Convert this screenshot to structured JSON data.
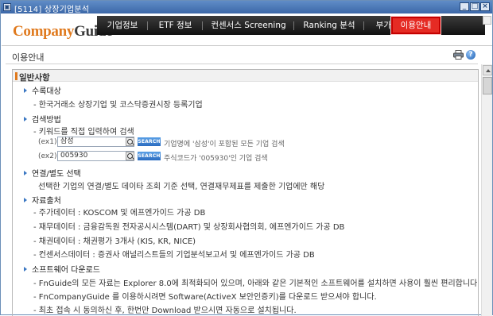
{
  "window": {
    "title": "[5114] 상장기업분석",
    "controls": [
      "_",
      "□",
      "×"
    ]
  },
  "header": {
    "logo_part1": "Company",
    "logo_part2": "Guide",
    "nav": [
      {
        "label": "기업정보"
      },
      {
        "label": "ETF 정보"
      },
      {
        "label": "컨센서스 Screening"
      },
      {
        "label": "Ranking 분석"
      },
      {
        "label": "부가정보"
      },
      {
        "label": "이용안내",
        "active": true
      }
    ]
  },
  "page": {
    "title": "이용안내",
    "print_icon": "printer-icon",
    "help_icon": "help-icon",
    "help_glyph": "?"
  },
  "content": {
    "section_title": "일반사항",
    "target": {
      "heading": "수록대상",
      "line": "- 한국거래소 상장기업 및 코스닥증권시장 등록기업"
    },
    "search": {
      "heading": "검색방법",
      "line": "- 키워드를 직접 입력하여 검색",
      "examples": [
        {
          "label": "(ex1)",
          "value": "삼성",
          "button": "SEARCH",
          "desc": "기업명에 '삼성'이 포함된 모든 기업 검색"
        },
        {
          "label": "(ex2)",
          "value": "005930",
          "button": "SEARCH",
          "desc": "주식코드가 '005930'인 기업 검색"
        }
      ]
    },
    "consolidated": {
      "heading": "연결/별도 선택",
      "line": "선택한 기업의 연결/별도 데이타 조회 기준 선택, 연결재무제표를 제출한 기업에만 해당"
    },
    "sources": {
      "heading": "자료출처",
      "lines": [
        "- 주가데이터 : KOSCOM 및 에프엔가이드 가공 DB",
        "- 재무데이터 : 금융감독원 전자공시시스템(DART) 및 상장회사협의회, 에프엔가이드 가공 DB",
        "- 채권데이터 : 채권평가 3개사 (KIS, KR, NICE)",
        "- 컨센서스데이터 : 증권사 애널리스트들의 기업분석보고서 및 에프엔가이드 가공 DB"
      ]
    },
    "software": {
      "heading": "소프트웨어 다운로드",
      "lines": [
        "- FnGuide의 모든 자료는 Explorer 8.0에 최적화되어 있으며, 아래와 같은 기본적인 소프트웨어를 설치하면 사용이 훨씬 편리합니다.",
        "- FnCompanyGuide 를 이용하시려면 Software(ActiveX 보안인증키)를 다운로드 받으셔야 합니다.",
        "- 최초 접속 시 동의하신 후, 한번만 Download 받으시면 자동으로 설치됩니다."
      ]
    }
  }
}
